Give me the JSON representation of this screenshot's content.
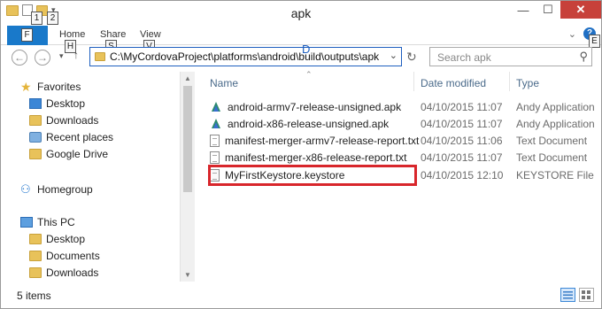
{
  "window": {
    "title": "apk"
  },
  "quick_access": {
    "keytips": [
      "1",
      "2"
    ]
  },
  "ribbon": {
    "file_keytip": "F",
    "tabs": [
      {
        "label": "Home",
        "keytip": "H"
      },
      {
        "label": "Share",
        "keytip": "S"
      },
      {
        "label": "View",
        "keytip": "V"
      }
    ],
    "help_keytip": "E"
  },
  "address": {
    "path": "C:\\MyCordovaProject\\platforms\\android\\build\\outputs\\apk",
    "keytip": "D"
  },
  "search": {
    "placeholder": "Search apk"
  },
  "nav_pane": {
    "favorites": {
      "label": "Favorites",
      "items": [
        "Desktop",
        "Downloads",
        "Recent places",
        "Google Drive"
      ]
    },
    "homegroup": "Homegroup",
    "this_pc": {
      "label": "This PC",
      "items": [
        "Desktop",
        "Documents",
        "Downloads"
      ]
    }
  },
  "file_list": {
    "columns": {
      "name": "Name",
      "date": "Date modified",
      "type": "Type"
    },
    "rows": [
      {
        "name": "android-armv7-release-unsigned.apk",
        "date": "04/10/2015 11:07",
        "type": "Andy Application",
        "icon": "apk-icon"
      },
      {
        "name": "android-x86-release-unsigned.apk",
        "date": "04/10/2015 11:07",
        "type": "Andy Application",
        "icon": "apk-icon"
      },
      {
        "name": "manifest-merger-armv7-release-report.txt",
        "date": "04/10/2015 11:06",
        "type": "Text Document",
        "icon": "text-file-icon"
      },
      {
        "name": "manifest-merger-x86-release-report.txt",
        "date": "04/10/2015 11:07",
        "type": "Text Document",
        "icon": "text-file-icon"
      },
      {
        "name": "MyFirstKeystore.keystore",
        "date": "04/10/2015 12:10",
        "type": "KEYSTORE File",
        "icon": "file-icon"
      }
    ],
    "highlight_color": "#d8262b"
  },
  "status": {
    "item_count": "5 items"
  }
}
